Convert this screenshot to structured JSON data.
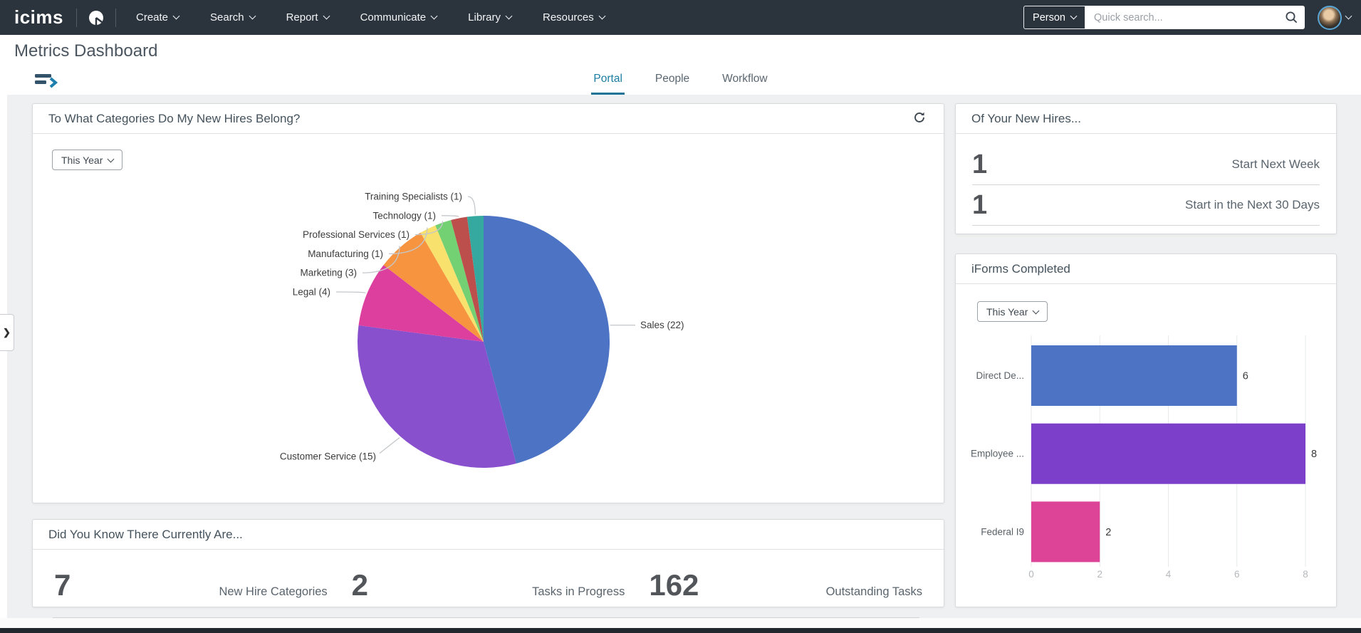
{
  "colors": {
    "navbar": "#2b333d",
    "accent": "#1b7da1"
  },
  "navbar": {
    "logo": "icims",
    "menus": [
      "Create",
      "Search",
      "Report",
      "Communicate",
      "Library",
      "Resources"
    ],
    "search_scope": "Person",
    "search_placeholder": "Quick search..."
  },
  "page": {
    "title": "Metrics Dashboard"
  },
  "tabs": [
    {
      "label": "Portal",
      "active": true
    },
    {
      "label": "People",
      "active": false
    },
    {
      "label": "Workflow",
      "active": false
    }
  ],
  "cards": {
    "categories": {
      "title": "To What Categories Do My New Hires Belong?",
      "filter": "This Year"
    },
    "did_you_know": {
      "title": "Did You Know There Currently Are...",
      "metrics": [
        {
          "value": "7",
          "label": "New Hire Categories"
        },
        {
          "value": "2",
          "label": "Tasks in Progress"
        },
        {
          "value": "162",
          "label": "Outstanding Tasks"
        }
      ]
    },
    "new_hires": {
      "title": "Of Your New Hires...",
      "metrics": [
        {
          "value": "1",
          "label": "Start Next Week"
        },
        {
          "value": "1",
          "label": "Start in the Next 30 Days"
        }
      ]
    },
    "iforms": {
      "title": "iForms Completed",
      "filter": "This Year"
    }
  },
  "chart_data": [
    {
      "type": "pie",
      "title": "To What Categories Do My New Hires Belong?",
      "label_format": "{label} ({value})",
      "slices": [
        {
          "label": "Sales",
          "value": 22,
          "color": "#4d73c4"
        },
        {
          "label": "Customer Service",
          "value": 15,
          "color": "#8950ce"
        },
        {
          "label": "Legal",
          "value": 4,
          "color": "#dd3f9e"
        },
        {
          "label": "Marketing",
          "value": 3,
          "color": "#f79440"
        },
        {
          "label": "Manufacturing",
          "value": 1,
          "color": "#f9e16e"
        },
        {
          "label": "Professional Services",
          "value": 1,
          "color": "#73d073"
        },
        {
          "label": "Technology",
          "value": 1,
          "color": "#bc4f4c"
        },
        {
          "label": "Training Specialists",
          "value": 1,
          "color": "#35a8a0"
        }
      ]
    },
    {
      "type": "bar",
      "orientation": "horizontal",
      "title": "iForms Completed",
      "categories": [
        "Direct De...",
        "Employee ...",
        "Federal I9"
      ],
      "values": [
        6,
        8,
        2
      ],
      "colors": [
        "#4d73c4",
        "#7b3fc9",
        "#dd4397"
      ],
      "xlim": [
        0,
        8
      ],
      "xticks": [
        0,
        2,
        4,
        6,
        8
      ],
      "grid": true
    }
  ]
}
